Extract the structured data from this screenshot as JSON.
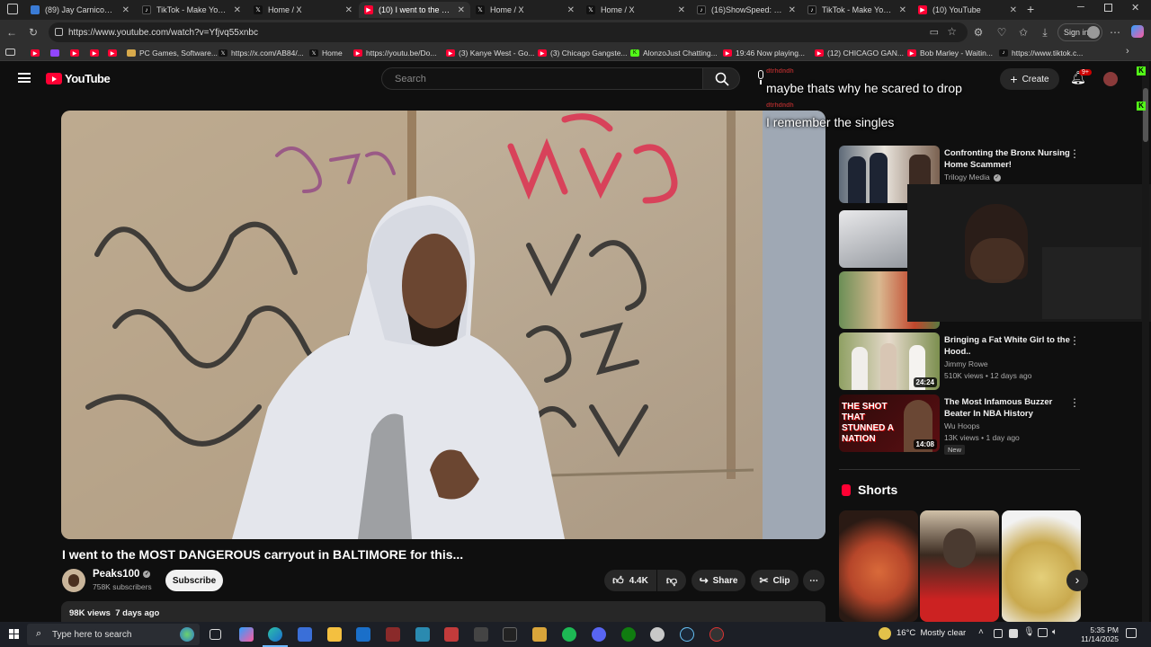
{
  "tabs": [
    {
      "title": "(89) Jay Carnicom DAP",
      "favicon": "#3a7bd5"
    },
    {
      "title": "TikTok - Make Your Day",
      "favicon": "#111111"
    },
    {
      "title": "Home / X",
      "favicon": "#111111"
    },
    {
      "title": "(10) I went to the MOST",
      "favicon": "#ff0033"
    },
    {
      "title": "Home / X",
      "favicon": "#111111"
    },
    {
      "title": "Home / X",
      "favicon": "#111111"
    },
    {
      "title": "(16)ShowSpeed: Speed",
      "favicon": "#111111"
    },
    {
      "title": "TikTok - Make Your Day",
      "favicon": "#111111"
    },
    {
      "title": "(10) YouTube",
      "favicon": "#ff0033"
    }
  ],
  "address": {
    "url": "https://www.youtube.com/watch?v=Yfjvq55xnbc",
    "signin_label": "Sign in"
  },
  "bookmarks": [
    {
      "label": ""
    },
    {
      "label": ""
    },
    {
      "label": ""
    },
    {
      "label": ""
    },
    {
      "label": ""
    },
    {
      "label": "PC Games, Software..."
    },
    {
      "label": "https://x.com/AB84/..."
    },
    {
      "label": "Home"
    },
    {
      "label": "https://youtu.be/Do..."
    },
    {
      "label": "(3) Kanye West - Go..."
    },
    {
      "label": "(3) Chicago Gangste..."
    },
    {
      "label": "AlonzoJust Chatting..."
    },
    {
      "label": "19:46 Now playing..."
    },
    {
      "label": "(12) CHICAGO GAN..."
    },
    {
      "label": "Bob Marley - Waitin..."
    },
    {
      "label": "https://www.tiktok.c..."
    }
  ],
  "youtube": {
    "logo": "YouTube",
    "search_placeholder": "Search",
    "create_label": "Create",
    "notification_count": "9+",
    "video": {
      "title": "I went to the MOST DANGEROUS carryout in BALTIMORE for this...",
      "channel": "Peaks100",
      "subscribers": "758K subscribers",
      "subscribe_label": "Subscribe",
      "likes": "4.4K",
      "share_label": "Share",
      "clip_label": "Clip",
      "meta": "98K views  7 days ago"
    },
    "recommendations": [
      {
        "title": "Confronting the Bronx Nursing Home Scammer!",
        "channel": "Trilogy Media",
        "meta": "",
        "duration": "",
        "badge": ""
      },
      {
        "title": "",
        "channel": "",
        "meta": "",
        "duration": "",
        "badge": ""
      },
      {
        "title": "",
        "channel": "",
        "meta": "",
        "duration": "",
        "badge": ""
      },
      {
        "title": "Bringing a Fat White Girl to the Hood..",
        "channel": "Jimmy Rowe",
        "meta": "510K views • 12 days ago",
        "duration": "24:24",
        "badge": ""
      },
      {
        "title": "The Most Infamous Buzzer Beater In NBA History",
        "channel": "Wu Hoops",
        "meta": "13K views • 1 day ago",
        "duration": "14:08",
        "badge": "New"
      }
    ],
    "thumb_caption": "THE SHOT THAT STUNNED A NATION",
    "shorts_title": "Shorts"
  },
  "chat": [
    {
      "user": "dtrhdndh",
      "message": "maybe thats why he scared to drop"
    },
    {
      "user": "dtrhdndh",
      "message": "I remember the singles"
    }
  ],
  "taskbar": {
    "search_placeholder": "Type here to search",
    "temperature": "16°C",
    "weather": "Mostly clear",
    "time": "5:35 PM",
    "date": "11/14/2025"
  }
}
